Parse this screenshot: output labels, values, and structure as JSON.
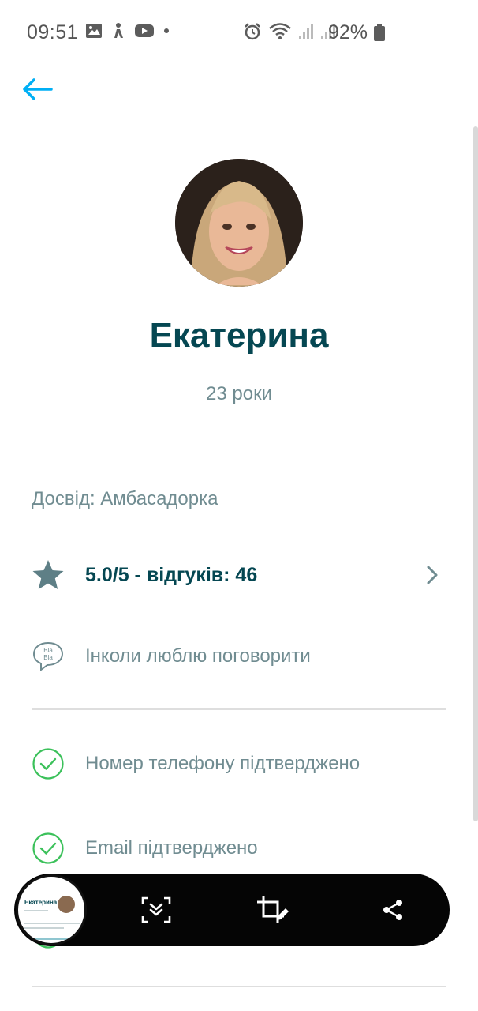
{
  "status_bar": {
    "time": "09:51",
    "battery": "92%",
    "left_icons": [
      "image-icon",
      "bus-person-icon",
      "youtube-icon",
      "dot-icon"
    ],
    "right_icons": [
      "alarm-icon",
      "wifi-icon",
      "signal-icon",
      "signal-icon"
    ]
  },
  "profile": {
    "name": "Екатерина",
    "age": "23 роки",
    "experience": "Досвід: Амбасадорка",
    "rating": "5.0/5 - відгуків: 46",
    "chat_preference": "Інколи люблю поговорити",
    "phone_verified": "Номер телефону підтверджено",
    "email_verified": "Email підтверджено"
  },
  "thumbnail": {
    "title": "Екатерина"
  },
  "colors": {
    "brand_dark": "#054752",
    "muted_text": "#708c91",
    "accent_blue": "#00aff5",
    "verified_green": "#3cc15b",
    "star": "#5e7f86"
  }
}
